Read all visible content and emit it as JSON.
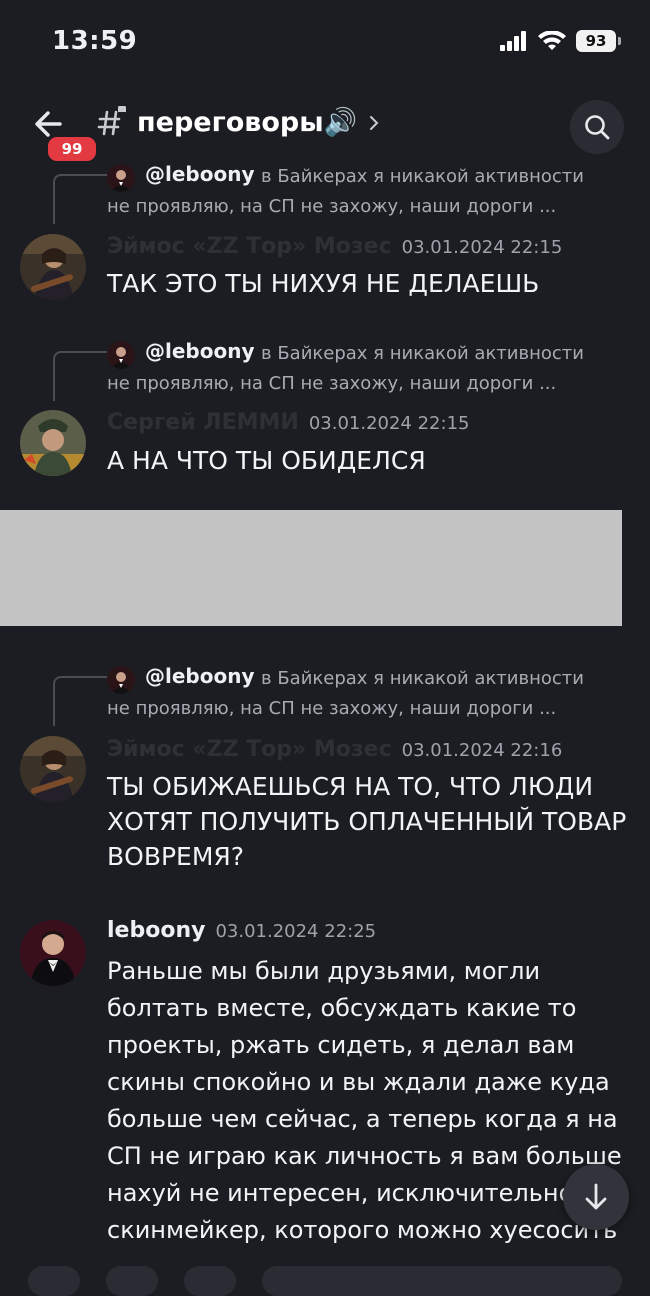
{
  "status_bar": {
    "time": "13:59",
    "battery": "93"
  },
  "header": {
    "badge": "99",
    "channel": "переговоры🔊"
  },
  "messages": [
    {
      "reply": {
        "name": "@leboony",
        "text_line1": "в Байкерах я никакой активности",
        "text_line2": "не проявляю, на СП не захожу, наши дороги ..."
      },
      "author": "Эймос «ZZ Тор» Мозес",
      "timestamp": "03.01.2024 22:15",
      "text": "ТАК ЭТО ТЫ НИХУЯ НЕ ДЕЛАЕШЬ"
    },
    {
      "reply": {
        "name": "@leboony",
        "text_line1": "в Байкерах я никакой активности",
        "text_line2": "не проявляю, на СП не захожу, наши дороги ..."
      },
      "author": "Сергей ЛЕММИ",
      "timestamp": "03.01.2024 22:15",
      "text": "А НА ЧТО ТЫ ОБИДЕЛСЯ"
    },
    {
      "reply": {
        "name": "@leboony",
        "text_line1": "в Байкерах я никакой активности",
        "text_line2": "не проявляю, на СП не захожу, наши дороги ..."
      },
      "author": "Эймос «ZZ Тор» Мозес",
      "timestamp": "03.01.2024 22:16",
      "text": "ТЫ ОБИЖАЕШЬСЯ НА ТО, ЧТО ЛЮДИ ХОТЯТ ПОЛУЧИТЬ ОПЛАЧЕННЫЙ ТОВАР ВОВРЕМЯ?"
    },
    {
      "author": "leboony",
      "timestamp": "03.01.2024 22:25",
      "text": "Раньше мы были друзьями, могли болтать вместе, обсуждать какие то проекты, ржать сидеть, я делал вам скины спокойно и вы ждали даже куда больше чем сейчас, а теперь когда я на СП не играю как личность я вам больше нахуй не интересен, исключительно скинмейкер, которого можно хуесосить"
    }
  ],
  "colors": {
    "background": "#1c1d22",
    "badge": "#e23a40",
    "author_faded": "#2e3036"
  }
}
